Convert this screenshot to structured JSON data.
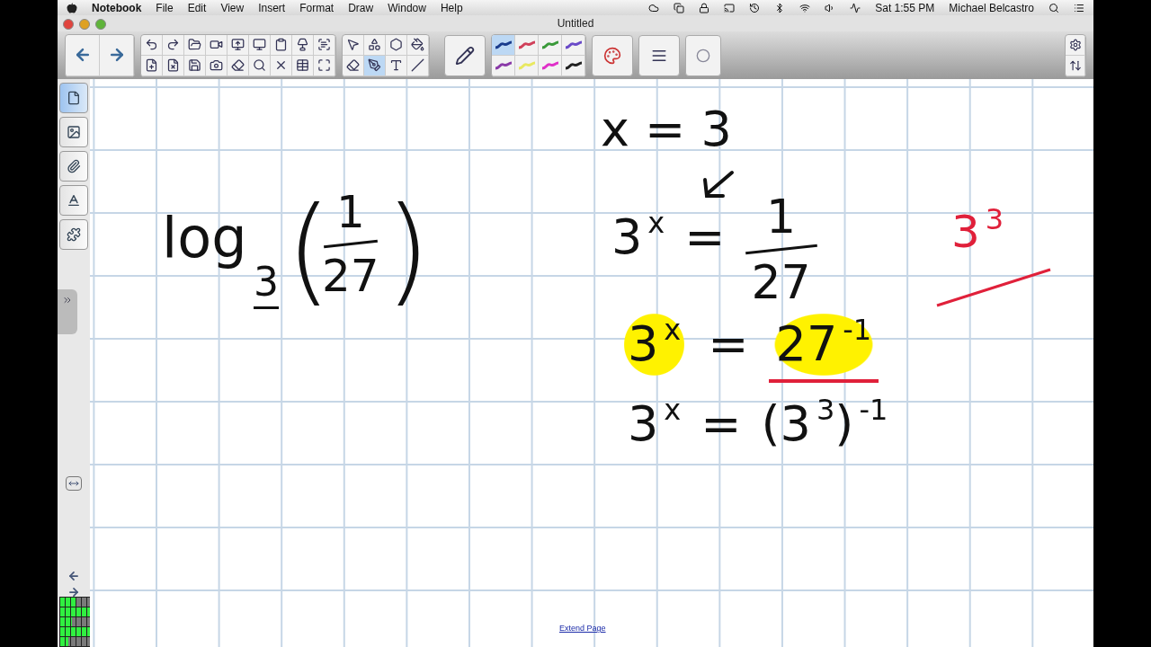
{
  "menu_bar": {
    "app": "Notebook",
    "items": [
      "File",
      "Edit",
      "View",
      "Insert",
      "Format",
      "Draw",
      "Window",
      "Help"
    ],
    "clock": "Sat 1:55 PM",
    "user": "Michael Belcastro"
  },
  "window": {
    "title": "Untitled"
  },
  "toolbar": {
    "nav": [
      {
        "kind": "back"
      },
      {
        "kind": "forward"
      }
    ],
    "actions": [
      {
        "kind": "undo"
      },
      {
        "kind": "redo"
      },
      {
        "kind": "open"
      },
      {
        "kind": "video"
      },
      {
        "kind": "shade"
      },
      {
        "kind": "display"
      },
      {
        "kind": "paste"
      },
      {
        "kind": "doccam"
      },
      {
        "kind": "recognize"
      },
      {
        "kind": "add-page"
      },
      {
        "kind": "delete-page"
      },
      {
        "kind": "save"
      },
      {
        "kind": "camera"
      },
      {
        "kind": "clear-ink"
      },
      {
        "kind": "magnify"
      },
      {
        "kind": "delete"
      },
      {
        "kind": "table"
      },
      {
        "kind": "fullscreen"
      }
    ],
    "tools": [
      {
        "kind": "select",
        "selected": false
      },
      {
        "kind": "shapes",
        "selected": false
      },
      {
        "kind": "polygon",
        "selected": false
      },
      {
        "kind": "fill",
        "selected": false
      },
      {
        "kind": "eraser",
        "selected": false
      },
      {
        "kind": "pens",
        "selected": true
      },
      {
        "kind": "text",
        "selected": false
      },
      {
        "kind": "line",
        "selected": false
      }
    ],
    "line_styles": [
      {
        "color": "#1a3c8c",
        "selected": true
      },
      {
        "color": "#d0405a",
        "selected": false
      },
      {
        "color": "#3a9a3a",
        "selected": false
      },
      {
        "color": "#6a4ac8",
        "selected": false
      },
      {
        "color": "#8a3aa8",
        "selected": false
      },
      {
        "color": "#e8e860",
        "selected": false
      },
      {
        "color": "#e030c8",
        "selected": false
      },
      {
        "color": "#202020",
        "selected": false
      }
    ]
  },
  "sidebar": {
    "tabs": [
      {
        "kind": "pages",
        "selected": true
      },
      {
        "kind": "gallery",
        "selected": false
      },
      {
        "kind": "attachments",
        "selected": false
      },
      {
        "kind": "properties",
        "selected": false
      },
      {
        "kind": "addons",
        "selected": false
      }
    ]
  },
  "page": {
    "problem": {
      "base": "log",
      "subscript": "3",
      "open_paren": "(",
      "numerator": "1",
      "denominator": "27",
      "close_paren": ")"
    },
    "steps": [
      [
        {
          "kind": "term",
          "text": "x = 3",
          "highlighted": false
        }
      ],
      [
        {
          "kind": "term",
          "text": "3",
          "sup": "x",
          "highlighted": false
        },
        {
          "kind": "op",
          "text": "="
        },
        {
          "kind": "fraction",
          "numerator": "1",
          "denominator": "27"
        }
      ],
      [
        {
          "kind": "term",
          "text": "3",
          "sup": "x",
          "highlighted": true
        },
        {
          "kind": "op",
          "text": "="
        },
        {
          "kind": "term",
          "text": "27",
          "sup": "-1",
          "highlighted": true,
          "underlined": true
        }
      ],
      [
        {
          "kind": "term",
          "text": "3",
          "sup": "x",
          "highlighted": false
        },
        {
          "kind": "op",
          "text": "="
        },
        {
          "kind": "term",
          "text": "(3",
          "sup": "3",
          "highlighted": false
        },
        {
          "kind": "term",
          "text": ")",
          "sup": "-1",
          "highlighted": false
        }
      ]
    ],
    "side_note": {
      "text": "3",
      "sup": "3"
    },
    "extend_link": "Extend Page"
  },
  "audio_meter": {
    "channels": [
      {
        "level": 0.15
      },
      {
        "level": 0.3
      },
      {
        "level": 0.12
      },
      {
        "level": 0.33
      },
      {
        "level": 0.08
      }
    ]
  }
}
